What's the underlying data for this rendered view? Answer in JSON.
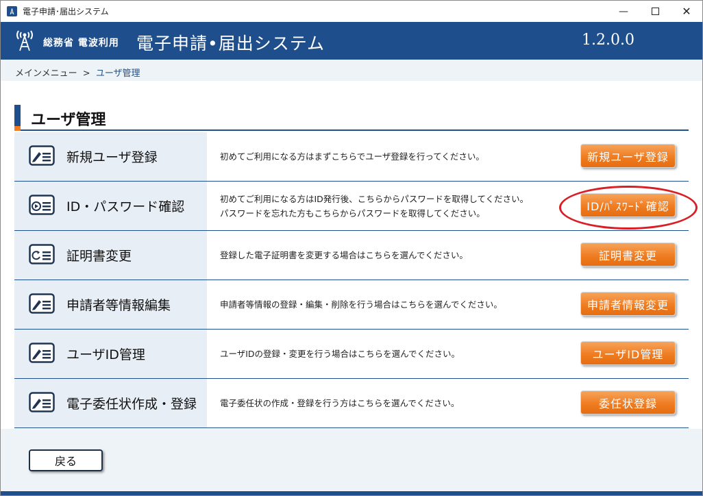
{
  "window": {
    "title": "電子申請･届出システム"
  },
  "header": {
    "org": "総務省 電波利用",
    "system_name": "電子申請•届出システム",
    "version": "1.2.0.0"
  },
  "breadcrumb": {
    "home": "メインメニュー",
    "separator": ">",
    "current": "ユーザ管理"
  },
  "page": {
    "title": "ユーザ管理"
  },
  "rows": [
    {
      "name": "新規ユーザ登録",
      "icon": "form-edit-icon",
      "desc": [
        "初めてご利用になる方はまずこちらでユーザ登録を行ってください。"
      ],
      "button": "新規ユーザ登録"
    },
    {
      "name": "ID・パスワード確認",
      "icon": "form-play-icon",
      "desc": [
        "初めてご利用になる方はID発行後、こちらからパスワードを取得してください。",
        "パスワードを忘れた方もこちらからパスワードを取得してください。"
      ],
      "button": "ID/ﾊﾟｽﾜｰﾄﾞ確認"
    },
    {
      "name": "証明書変更",
      "icon": "form-refresh-icon",
      "desc": [
        "登録した電子証明書を変更する場合はこちらを選んでください。"
      ],
      "button": "証明書変更"
    },
    {
      "name": "申請者等情報編集",
      "icon": "form-edit-icon",
      "desc": [
        "申請者等情報の登録・編集・削除を行う場合はこちらを選んでください。"
      ],
      "button": "申請者情報変更"
    },
    {
      "name": "ユーザID管理",
      "icon": "form-edit-icon",
      "desc": [
        "ユーザIDの登録・変更を行う場合はこちらを選んでください。"
      ],
      "button": "ユーザID管理"
    },
    {
      "name": "電子委任状作成・登録",
      "icon": "form-edit-icon",
      "desc": [
        "電子委任状の作成・登録を行う方はこちらを選んでください。"
      ],
      "button": "委任状登録"
    }
  ],
  "footer": {
    "back_label": "戻る"
  },
  "colors": {
    "brand_blue": "#1f4e8c",
    "accent_orange": "#ef7d22",
    "highlight_red": "#d81f26"
  }
}
